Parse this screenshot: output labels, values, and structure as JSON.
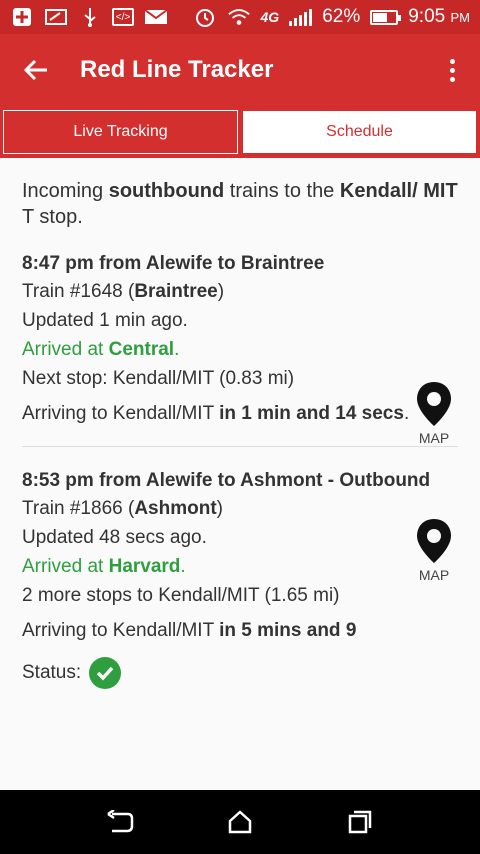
{
  "status_bar": {
    "battery_text": "62%",
    "battery_level": 0.62,
    "time": "9:05",
    "time_suffix": "PM",
    "network": "4G LTE",
    "icons": [
      "plus-icon",
      "message-icon",
      "usb-icon",
      "code-icon",
      "mail-icon",
      "alarm-icon",
      "wifi-icon",
      "network-icon",
      "signal-icon",
      "battery-icon"
    ]
  },
  "toolbar": {
    "title": "Red Line Tracker",
    "back_icon": "back-arrow-icon",
    "menu_icon": "overflow-menu-icon"
  },
  "tabs": [
    {
      "label": "Live Tracking",
      "active": true
    },
    {
      "label": "Schedule",
      "active": false
    }
  ],
  "intro": {
    "pre": "Incoming ",
    "direction": "southbound",
    "mid": " trains to the ",
    "stop": "Kendall/ MIT",
    "post": " T stop."
  },
  "trains": [
    {
      "title": "8:47 pm from Alewife to Braintree",
      "train_prefix": "Train #1648 (",
      "train_dest": "Braintree",
      "train_suffix": ")",
      "updated": "Updated 1 min ago.",
      "arrived_prefix": "Arrived at ",
      "arrived_station": "Central",
      "arrived_suffix": ".",
      "next_stop": "Next stop: Kendall/MIT (0.83 mi)",
      "arriving_prefix": "Arriving to Kendall/MIT ",
      "arriving_time": "in 1 min and 14 secs",
      "arriving_suffix": ".",
      "map_label": "MAP"
    },
    {
      "title": "8:53 pm from Alewife to Ashmont - Outbound",
      "train_prefix": "Train #1866 (",
      "train_dest": "Ashmont",
      "train_suffix": ")",
      "updated": "Updated 48 secs ago.",
      "arrived_prefix": "Arrived at ",
      "arrived_station": "Harvard",
      "arrived_suffix": ".",
      "next_stop": "2 more stops to Kendall/MIT (1.65 mi)",
      "arriving_prefix": "Arriving to Kendall/MIT ",
      "arriving_time": "in 5 mins and 9",
      "arriving_suffix": "",
      "map_label": "MAP",
      "status_label": "Status:"
    }
  ],
  "nav_bar": {
    "icons": [
      "back-nav-icon",
      "home-nav-icon",
      "recents-nav-icon"
    ]
  },
  "colors": {
    "primary": "#d32f2f",
    "status_bar": "#c62828",
    "arrived_green": "#2e9e3e"
  }
}
